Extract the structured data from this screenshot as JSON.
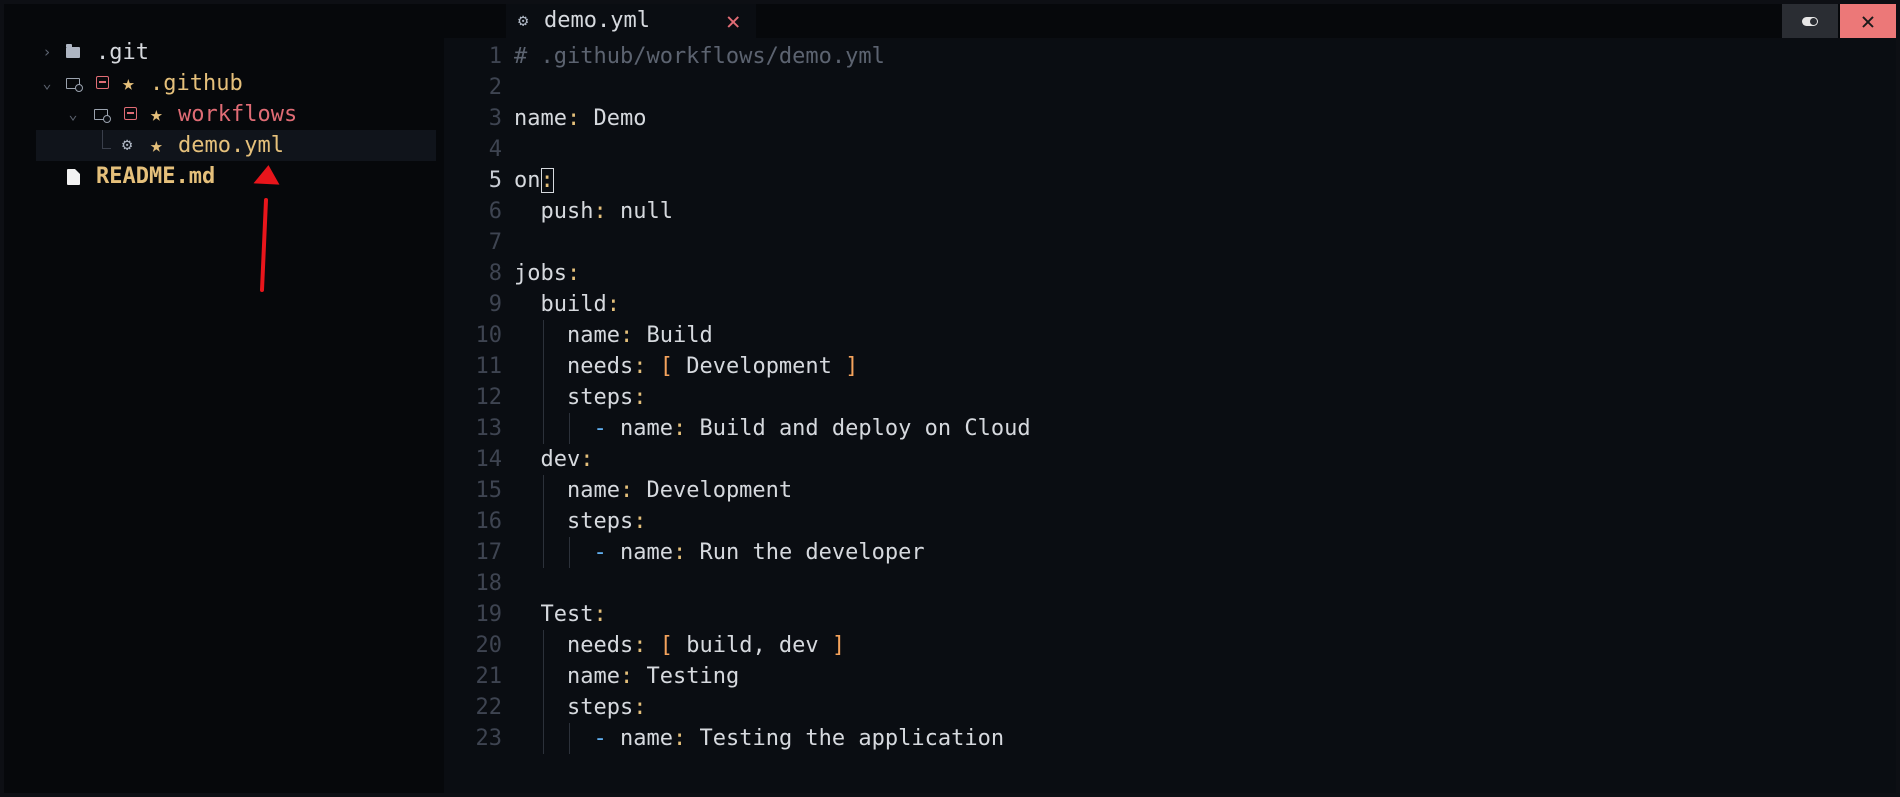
{
  "sidebar": {
    "items": [
      {
        "name": ".git"
      },
      {
        "name": ".github"
      },
      {
        "name": "workflows"
      },
      {
        "name": "demo.yml"
      },
      {
        "name": "README.md"
      }
    ],
    "star_glyph": "★"
  },
  "tab": {
    "title": "demo.yml",
    "close_glyph": "✕"
  },
  "window": {
    "close_glyph": "✕"
  },
  "colors": {
    "accent_red": "#e06c75",
    "accent_yellow": "#e5c07b",
    "close_bg": "#ec7878"
  },
  "editor": {
    "current_line": 5,
    "lines": [
      {
        "n": "1",
        "comment": "# .github/workflows/demo.yml"
      },
      {
        "n": "2"
      },
      {
        "n": "3",
        "key": "name",
        "value": "Demo"
      },
      {
        "n": "4"
      },
      {
        "n": "5",
        "key": "on"
      },
      {
        "n": "6",
        "indent": "  ",
        "key": "push",
        "value": "null"
      },
      {
        "n": "7"
      },
      {
        "n": "8",
        "key": "jobs"
      },
      {
        "n": "9",
        "indent": "  ",
        "key": "build"
      },
      {
        "n": "10",
        "indent": "    ",
        "key": "name",
        "value": "Build"
      },
      {
        "n": "11",
        "indent": "    ",
        "key": "needs",
        "list": "Development"
      },
      {
        "n": "12",
        "indent": "    ",
        "key": "steps"
      },
      {
        "n": "13",
        "indent": "      ",
        "dash": "-",
        "key": "name",
        "value": "Build and deploy on Cloud"
      },
      {
        "n": "14",
        "indent": "  ",
        "key": "dev"
      },
      {
        "n": "15",
        "indent": "    ",
        "key": "name",
        "value": "Development"
      },
      {
        "n": "16",
        "indent": "    ",
        "key": "steps"
      },
      {
        "n": "17",
        "indent": "      ",
        "dash": "-",
        "key": "name",
        "value": "Run the developer"
      },
      {
        "n": "18"
      },
      {
        "n": "19",
        "indent": "  ",
        "key": "Test"
      },
      {
        "n": "20",
        "indent": "    ",
        "key": "needs",
        "list": "build, dev"
      },
      {
        "n": "21",
        "indent": "    ",
        "key": "name",
        "value": "Testing"
      },
      {
        "n": "22",
        "indent": "    ",
        "key": "steps"
      },
      {
        "n": "23",
        "indent": "      ",
        "dash": "-",
        "key": "name",
        "value": "Testing the application"
      }
    ]
  }
}
